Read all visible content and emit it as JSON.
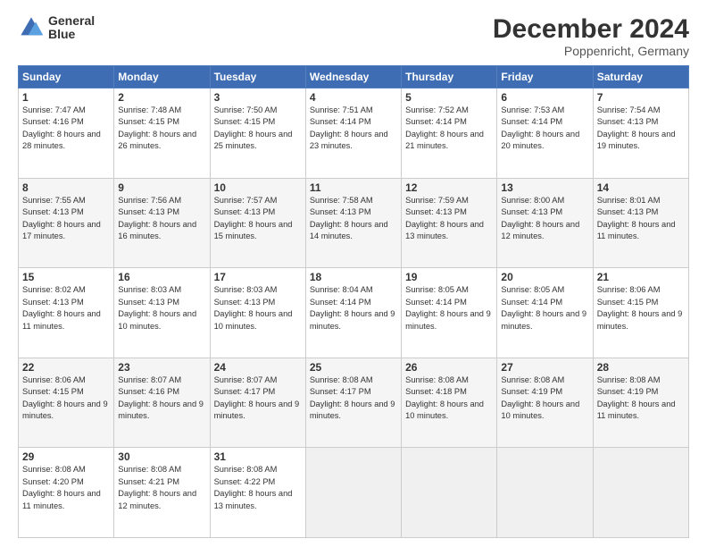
{
  "header": {
    "logo_line1": "General",
    "logo_line2": "Blue",
    "title": "December 2024",
    "subtitle": "Poppenricht, Germany"
  },
  "days_of_week": [
    "Sunday",
    "Monday",
    "Tuesday",
    "Wednesday",
    "Thursday",
    "Friday",
    "Saturday"
  ],
  "weeks": [
    [
      {
        "day": 1,
        "sunrise": "7:47 AM",
        "sunset": "4:16 PM",
        "daylight": "8 hours and 28 minutes."
      },
      {
        "day": 2,
        "sunrise": "7:48 AM",
        "sunset": "4:15 PM",
        "daylight": "8 hours and 26 minutes."
      },
      {
        "day": 3,
        "sunrise": "7:50 AM",
        "sunset": "4:15 PM",
        "daylight": "8 hours and 25 minutes."
      },
      {
        "day": 4,
        "sunrise": "7:51 AM",
        "sunset": "4:14 PM",
        "daylight": "8 hours and 23 minutes."
      },
      {
        "day": 5,
        "sunrise": "7:52 AM",
        "sunset": "4:14 PM",
        "daylight": "8 hours and 21 minutes."
      },
      {
        "day": 6,
        "sunrise": "7:53 AM",
        "sunset": "4:14 PM",
        "daylight": "8 hours and 20 minutes."
      },
      {
        "day": 7,
        "sunrise": "7:54 AM",
        "sunset": "4:13 PM",
        "daylight": "8 hours and 19 minutes."
      }
    ],
    [
      {
        "day": 8,
        "sunrise": "7:55 AM",
        "sunset": "4:13 PM",
        "daylight": "8 hours and 17 minutes."
      },
      {
        "day": 9,
        "sunrise": "7:56 AM",
        "sunset": "4:13 PM",
        "daylight": "8 hours and 16 minutes."
      },
      {
        "day": 10,
        "sunrise": "7:57 AM",
        "sunset": "4:13 PM",
        "daylight": "8 hours and 15 minutes."
      },
      {
        "day": 11,
        "sunrise": "7:58 AM",
        "sunset": "4:13 PM",
        "daylight": "8 hours and 14 minutes."
      },
      {
        "day": 12,
        "sunrise": "7:59 AM",
        "sunset": "4:13 PM",
        "daylight": "8 hours and 13 minutes."
      },
      {
        "day": 13,
        "sunrise": "8:00 AM",
        "sunset": "4:13 PM",
        "daylight": "8 hours and 12 minutes."
      },
      {
        "day": 14,
        "sunrise": "8:01 AM",
        "sunset": "4:13 PM",
        "daylight": "8 hours and 11 minutes."
      }
    ],
    [
      {
        "day": 15,
        "sunrise": "8:02 AM",
        "sunset": "4:13 PM",
        "daylight": "8 hours and 11 minutes."
      },
      {
        "day": 16,
        "sunrise": "8:03 AM",
        "sunset": "4:13 PM",
        "daylight": "8 hours and 10 minutes."
      },
      {
        "day": 17,
        "sunrise": "8:03 AM",
        "sunset": "4:13 PM",
        "daylight": "8 hours and 10 minutes."
      },
      {
        "day": 18,
        "sunrise": "8:04 AM",
        "sunset": "4:14 PM",
        "daylight": "8 hours and 9 minutes."
      },
      {
        "day": 19,
        "sunrise": "8:05 AM",
        "sunset": "4:14 PM",
        "daylight": "8 hours and 9 minutes."
      },
      {
        "day": 20,
        "sunrise": "8:05 AM",
        "sunset": "4:14 PM",
        "daylight": "8 hours and 9 minutes."
      },
      {
        "day": 21,
        "sunrise": "8:06 AM",
        "sunset": "4:15 PM",
        "daylight": "8 hours and 9 minutes."
      }
    ],
    [
      {
        "day": 22,
        "sunrise": "8:06 AM",
        "sunset": "4:15 PM",
        "daylight": "8 hours and 9 minutes."
      },
      {
        "day": 23,
        "sunrise": "8:07 AM",
        "sunset": "4:16 PM",
        "daylight": "8 hours and 9 minutes."
      },
      {
        "day": 24,
        "sunrise": "8:07 AM",
        "sunset": "4:17 PM",
        "daylight": "8 hours and 9 minutes."
      },
      {
        "day": 25,
        "sunrise": "8:08 AM",
        "sunset": "4:17 PM",
        "daylight": "8 hours and 9 minutes."
      },
      {
        "day": 26,
        "sunrise": "8:08 AM",
        "sunset": "4:18 PM",
        "daylight": "8 hours and 10 minutes."
      },
      {
        "day": 27,
        "sunrise": "8:08 AM",
        "sunset": "4:19 PM",
        "daylight": "8 hours and 10 minutes."
      },
      {
        "day": 28,
        "sunrise": "8:08 AM",
        "sunset": "4:19 PM",
        "daylight": "8 hours and 11 minutes."
      }
    ],
    [
      {
        "day": 29,
        "sunrise": "8:08 AM",
        "sunset": "4:20 PM",
        "daylight": "8 hours and 11 minutes."
      },
      {
        "day": 30,
        "sunrise": "8:08 AM",
        "sunset": "4:21 PM",
        "daylight": "8 hours and 12 minutes."
      },
      {
        "day": 31,
        "sunrise": "8:08 AM",
        "sunset": "4:22 PM",
        "daylight": "8 hours and 13 minutes."
      },
      null,
      null,
      null,
      null
    ]
  ]
}
